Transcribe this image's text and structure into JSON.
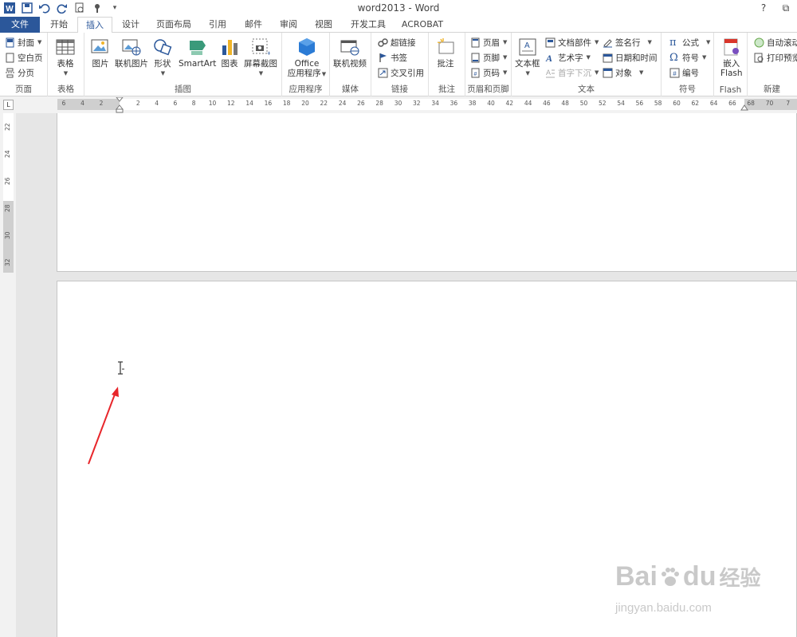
{
  "window": {
    "title": "word2013 - Word",
    "help": "?",
    "restore": "⧉"
  },
  "tabs": [
    {
      "label": "文件"
    },
    {
      "label": "开始"
    },
    {
      "label": "插入"
    },
    {
      "label": "设计"
    },
    {
      "label": "页面布局"
    },
    {
      "label": "引用"
    },
    {
      "label": "邮件"
    },
    {
      "label": "审阅"
    },
    {
      "label": "视图"
    },
    {
      "label": "开发工具"
    },
    {
      "label": "ACROBAT"
    }
  ],
  "ribbon": {
    "pages": {
      "label": "页面",
      "cover": "封面",
      "blank": "空白页",
      "break": "分页"
    },
    "tables": {
      "label": "表格",
      "table": "表格"
    },
    "illustrations": {
      "label": "插图",
      "picture": "图片",
      "online_picture": "联机图片",
      "shapes": "形状",
      "smartart": "SmartArt",
      "chart": "图表",
      "screenshot": "屏幕截图"
    },
    "apps": {
      "label": "应用程序",
      "office_line1": "Office",
      "office_line2": "应用程序"
    },
    "media": {
      "label": "媒体",
      "online_video": "联机视频"
    },
    "links": {
      "label": "链接",
      "hyperlink": "超链接",
      "bookmark": "书签",
      "cross_ref": "交叉引用"
    },
    "comments": {
      "label": "批注",
      "comment": "批注"
    },
    "header_footer": {
      "label": "页眉和页脚",
      "header": "页眉",
      "footer": "页脚",
      "page_number": "页码"
    },
    "text": {
      "label": "文本",
      "textbox": "文本框",
      "quick_parts": "文档部件",
      "wordart": "艺术字",
      "dropcap": "首字下沉",
      "signature": "签名行",
      "datetime": "日期和时间",
      "object": "对象"
    },
    "symbols": {
      "label": "符号",
      "equation": "公式",
      "symbol": "符号",
      "number": "编号"
    },
    "flash": {
      "label": "Flash",
      "embed_line1": "嵌入",
      "embed_line2": "Flash"
    },
    "new": {
      "label": "新建",
      "auto_scroll": "自动滚动",
      "print_preview": "打印预览"
    }
  },
  "ruler": {
    "selector": "L",
    "h_numbers": [
      "6",
      "4",
      "2",
      "2",
      "4",
      "6",
      "8",
      "10",
      "12",
      "14",
      "16",
      "18",
      "20",
      "22",
      "24",
      "26",
      "28",
      "30",
      "32",
      "34",
      "36",
      "38",
      "40",
      "42",
      "44",
      "46",
      "48",
      "50",
      "52",
      "54",
      "56",
      "58",
      "60",
      "62",
      "64",
      "66",
      "68",
      "70",
      "7"
    ],
    "v_numbers": [
      "22",
      "24",
      "26",
      "28",
      "30",
      "32"
    ]
  },
  "watermark": {
    "logo_latin": "Bai",
    "logo_du": "du",
    "logo_zh": "经验",
    "url": "jingyan.baidu.com"
  },
  "colors": {
    "accent": "#2b579a",
    "arrow": "#e8262b"
  }
}
